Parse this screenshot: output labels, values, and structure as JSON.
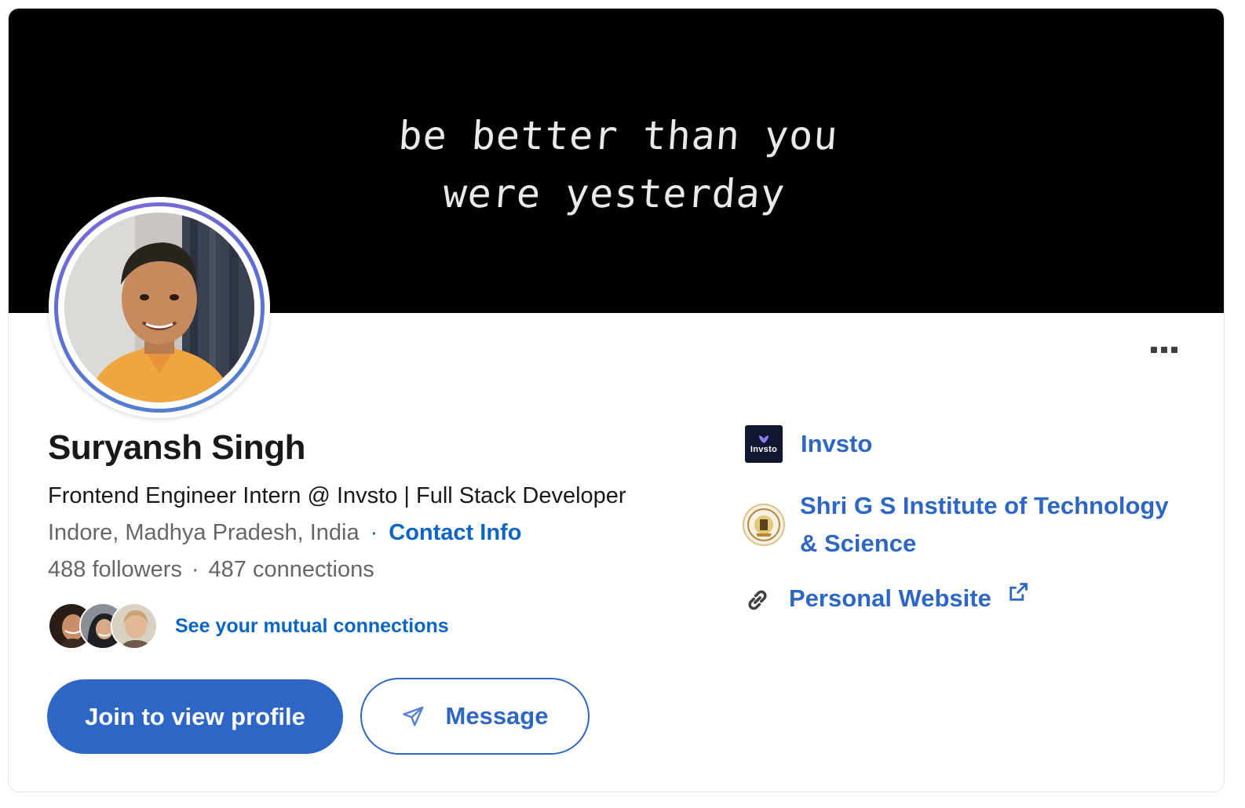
{
  "banner": {
    "quote_line1": "be better than you",
    "quote_line2": "were yesterday"
  },
  "profile": {
    "name": "Suryansh Singh",
    "headline": "Frontend Engineer Intern @ Invsto | Full Stack Developer",
    "location": "Indore, Madhya Pradesh, India",
    "location_separator": "·",
    "contact_info_label": "Contact Info",
    "followers": "488 followers",
    "stats_separator": "·",
    "connections": "487 connections",
    "mutual_connections_label": "See your mutual connections"
  },
  "actions": {
    "join_label": "Join to view profile",
    "message_label": "Message"
  },
  "sidebar": {
    "company": "Invsto",
    "company_logo_text": "Invsto",
    "school": "Shri G S Institute of Technology & Science",
    "website": "Personal Website"
  },
  "colors": {
    "accent": "#2e66c5",
    "banner_bg": "#000000",
    "text_primary": "#191919",
    "text_secondary": "#666666"
  },
  "icons": {
    "more": "more-icon",
    "send": "send-icon",
    "link": "link-icon",
    "external": "external-link-icon"
  }
}
